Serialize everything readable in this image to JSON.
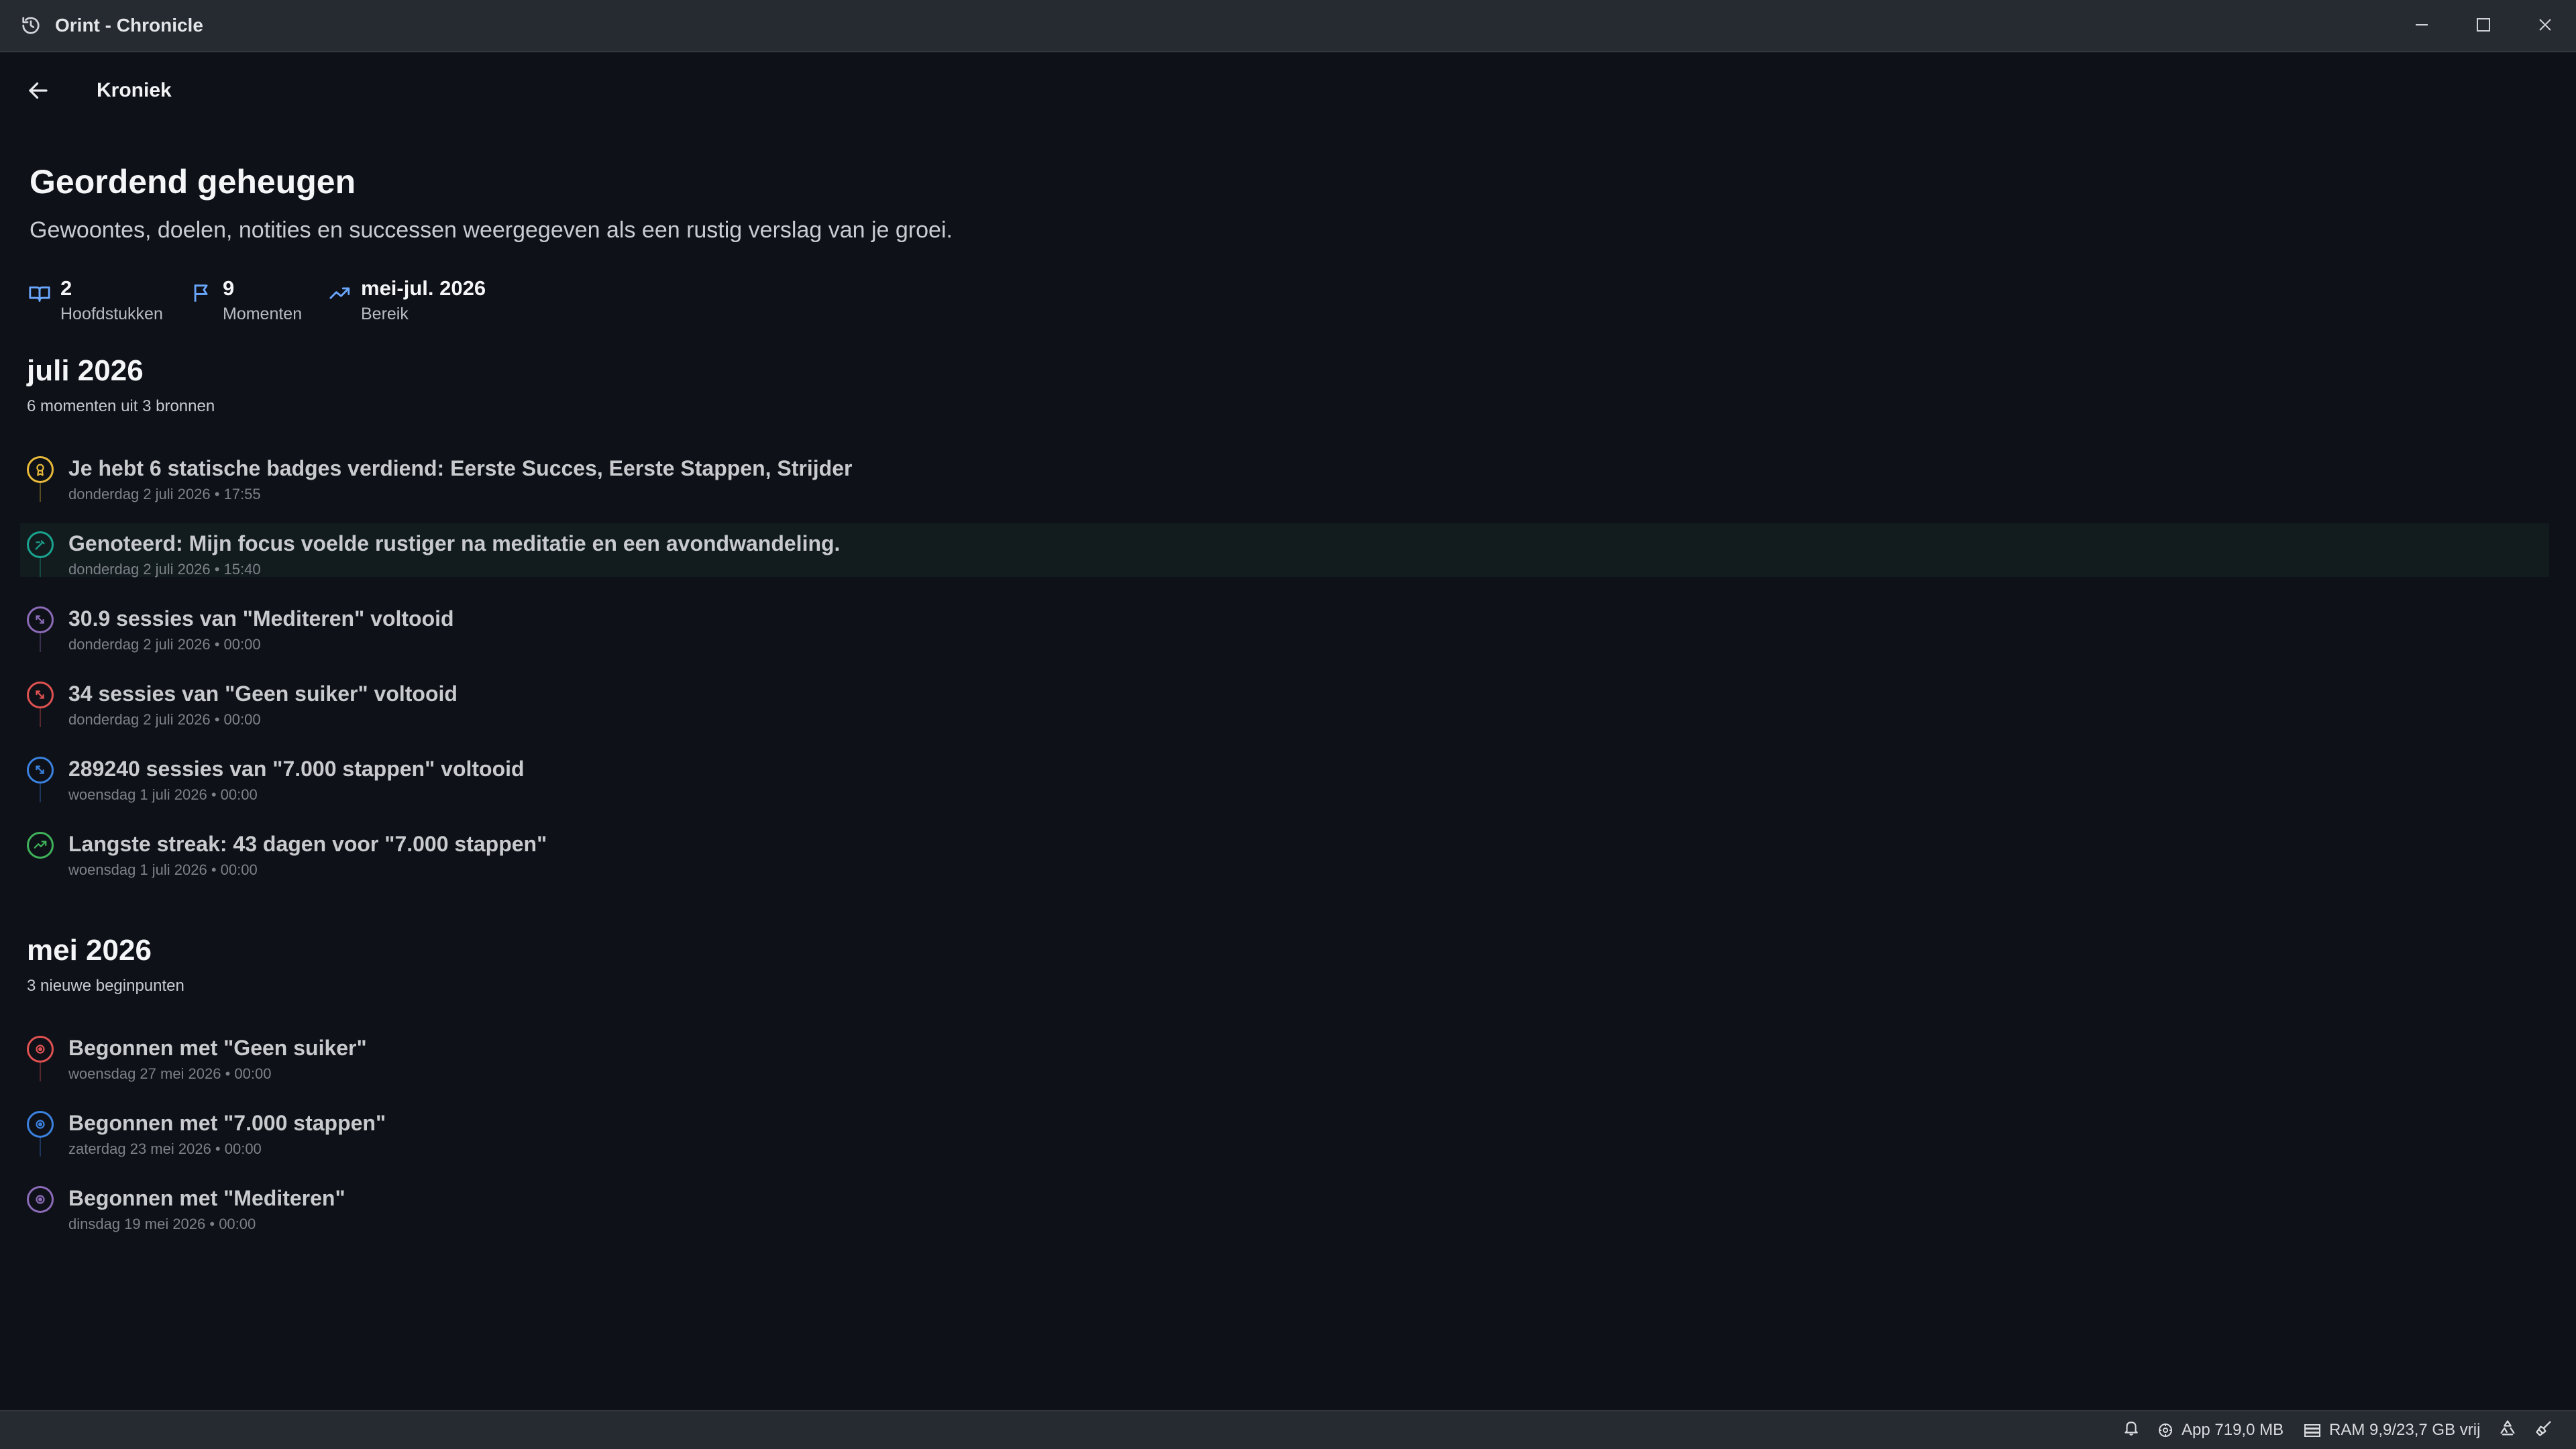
{
  "window": {
    "title": "Orint - Chronicle",
    "icons": {
      "app": "history-icon",
      "minimize": "minimize-icon",
      "maximize": "maximize-icon",
      "close": "close-icon"
    }
  },
  "header": {
    "back_icon": "arrow-left-icon",
    "crumb": "Kroniek"
  },
  "hero": {
    "title": "Geordend geheugen",
    "subtitle": "Gewoontes, doelen, notities en successen weergegeven als een rustig verslag van je groei."
  },
  "stats": [
    {
      "value": "2",
      "label": "Hoofdstukken",
      "icon": "book-icon"
    },
    {
      "value": "9",
      "label": "Momenten",
      "icon": "flag-icon"
    },
    {
      "value": "mei-jul. 2026",
      "label": "Bereik",
      "icon": "trend-icon"
    }
  ],
  "sections": [
    {
      "title": "juli 2026",
      "subtitle": "6 momenten uit 3 bronnen",
      "entries": [
        {
          "title": "Je hebt 6 statische badges verdiend: Eerste Succes, Eerste Stappen, Strijder",
          "date": "donderdag 2 juli 2026 • 17:55",
          "icon": "badge-icon",
          "color": "#e8b93a"
        },
        {
          "title": "Genoteerd: Mijn focus voelde rustiger na meditatie en een avondwandeling.",
          "date": "donderdag 2 juli 2026 • 15:40",
          "icon": "note-icon",
          "color": "#1aa38f"
        },
        {
          "title": "30.9 sessies van \"Mediteren\" voltooid",
          "date": "donderdag 2 juli 2026 • 00:00",
          "icon": "repeat-icon",
          "color": "#8c6bb8"
        },
        {
          "title": "34 sessies van \"Geen suiker\" voltooid",
          "date": "donderdag 2 juli 2026 • 00:00",
          "icon": "repeat-icon",
          "color": "#e05252"
        },
        {
          "title": "289240 sessies van \"7.000 stappen\" voltooid",
          "date": "woensdag 1 juli 2026 • 00:00",
          "icon": "repeat-icon",
          "color": "#3b82e0"
        },
        {
          "title": "Langste streak: 43 dagen voor \"7.000 stappen\"",
          "date": "woensdag 1 juli 2026 • 00:00",
          "icon": "trend-icon",
          "color": "#3fb15a"
        }
      ]
    },
    {
      "title": "mei 2026",
      "subtitle": "3 nieuwe beginpunten",
      "entries": [
        {
          "title": "Begonnen met \"Geen suiker\"",
          "date": "woensdag 27 mei 2026 • 00:00",
          "icon": "start-icon",
          "color": "#e05252"
        },
        {
          "title": "Begonnen met \"7.000 stappen\"",
          "date": "zaterdag 23 mei 2026 • 00:00",
          "icon": "start-icon",
          "color": "#3b82e0"
        },
        {
          "title": "Begonnen met \"Mediteren\"",
          "date": "dinsdag 19 mei 2026 • 00:00",
          "icon": "start-icon",
          "color": "#8c6bb8"
        }
      ]
    }
  ],
  "statusbar": {
    "app_memory": "App 719,0 MB",
    "ram": "RAM 9,9/23,7 GB vrij",
    "icons": [
      "bell-icon",
      "app-memory-icon",
      "ram-icon",
      "sync-icon",
      "broom-icon"
    ]
  },
  "colors": {
    "background": "#0e1117",
    "titlebar": "#262a31",
    "accent_blue": "#6aa7ff",
    "highlight_row": "#121c1e"
  }
}
